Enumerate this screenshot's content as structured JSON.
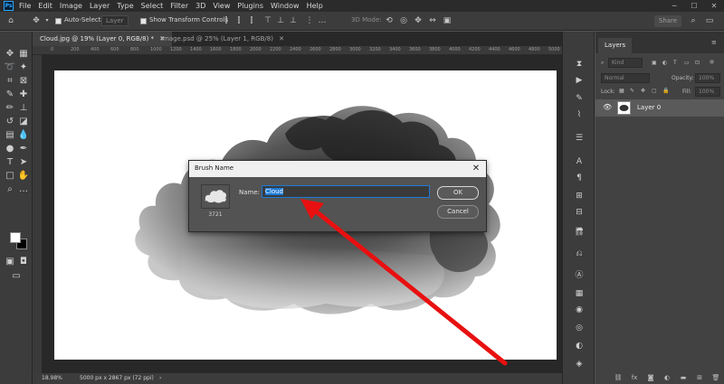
{
  "menubar": {
    "app_logo": "Ps",
    "items": [
      "File",
      "Edit",
      "Image",
      "Layer",
      "Type",
      "Select",
      "Filter",
      "3D",
      "View",
      "Plugins",
      "Window",
      "Help"
    ]
  },
  "options": {
    "auto_select_label": "Auto-Select:",
    "auto_select_value": "Layer",
    "transform_label": "Show Transform Controls",
    "mode_3d_label": "3D Mode:",
    "share_label": "Share"
  },
  "tabs": [
    {
      "label": "Cloud.jpg @ 19% (Layer 0, RGB/8) *",
      "active": true
    },
    {
      "label": "Image.psd @ 25% (Layer 1, RGB/8)",
      "active": false
    }
  ],
  "ruler_ticks": [
    "0",
    "200",
    "400",
    "600",
    "800",
    "1000",
    "1200",
    "1400",
    "1600",
    "1800",
    "2000",
    "2200",
    "2400",
    "2600",
    "2800",
    "3000",
    "3200",
    "3400",
    "3600",
    "3800",
    "4000",
    "4200",
    "4400",
    "4600",
    "4800",
    "5000"
  ],
  "status": {
    "zoom": "18.98%",
    "doc_info": "5000 px x 2867 px (72 ppi)"
  },
  "layers_panel": {
    "title": "Layers",
    "kind_placeholder": "Kind",
    "blend_mode": "Normal",
    "opacity_label": "Opacity:",
    "opacity_value": "100%",
    "lock_label": "Lock:",
    "fill_label": "Fill:",
    "fill_value": "100%",
    "layers": [
      {
        "name": "Layer 0",
        "visible": true
      }
    ]
  },
  "dialog": {
    "title": "Brush Name",
    "close": "✕",
    "brush_size": "3721",
    "name_label": "Name:",
    "name_value": "Cloud",
    "ok_label": "OK",
    "cancel_label": "Cancel"
  },
  "colors": {
    "accent": "#1d7ad6",
    "annotation_arrow": "#e81010",
    "foreground": "#ffffff",
    "background": "#000000"
  }
}
